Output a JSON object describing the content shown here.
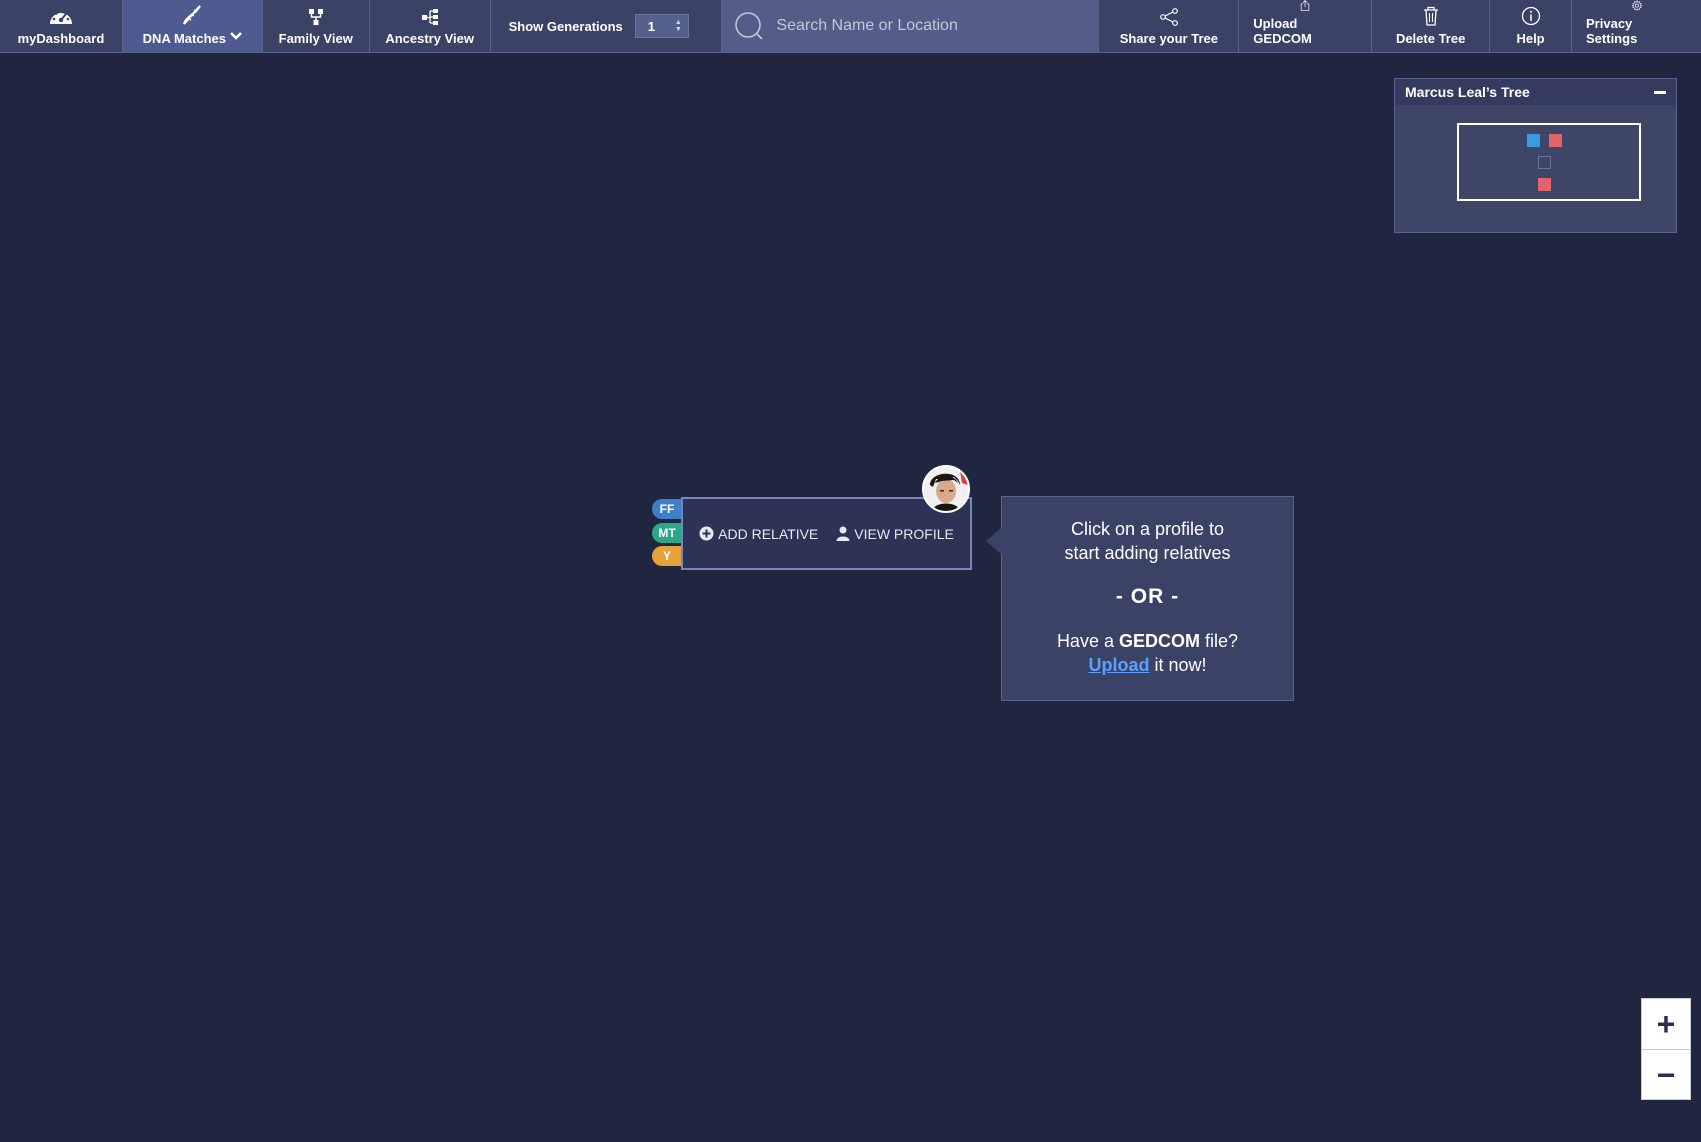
{
  "nav": {
    "dashboard": "myDashboard",
    "dna_matches": "DNA Matches",
    "family_view": "Family View",
    "ancestry_view": "Ancestry View",
    "show_generations_label": "Show Generations",
    "generations_value": "1",
    "search_placeholder": "Search Name or Location",
    "share": "Share your Tree",
    "upload": "Upload GEDCOM",
    "delete": "Delete Tree",
    "help": "Help",
    "privacy": "Privacy Settings"
  },
  "tree_panel": {
    "title": "Marcus Leal’s Tree",
    "colors": {
      "male": "#3a9be0",
      "female": "#e0646a",
      "unknown": "#4a5272"
    }
  },
  "person": {
    "badges": [
      {
        "label": "FF",
        "color": "#3f7fc8"
      },
      {
        "label": "MT",
        "color": "#2aa889"
      },
      {
        "label": "Y",
        "color": "#e8a23a"
      }
    ],
    "add_relative": "ADD RELATIVE",
    "view_profile": "VIEW PROFILE"
  },
  "tooltip": {
    "line1": "Click on a profile to",
    "line2": "start adding relatives",
    "or": "- OR -",
    "have_a": "Have a",
    "gedcom": "GEDCOM",
    "file": "file?",
    "upload_link": "Upload",
    "it_now": "it now!"
  },
  "zoom": {
    "in": "+",
    "out": "−"
  }
}
